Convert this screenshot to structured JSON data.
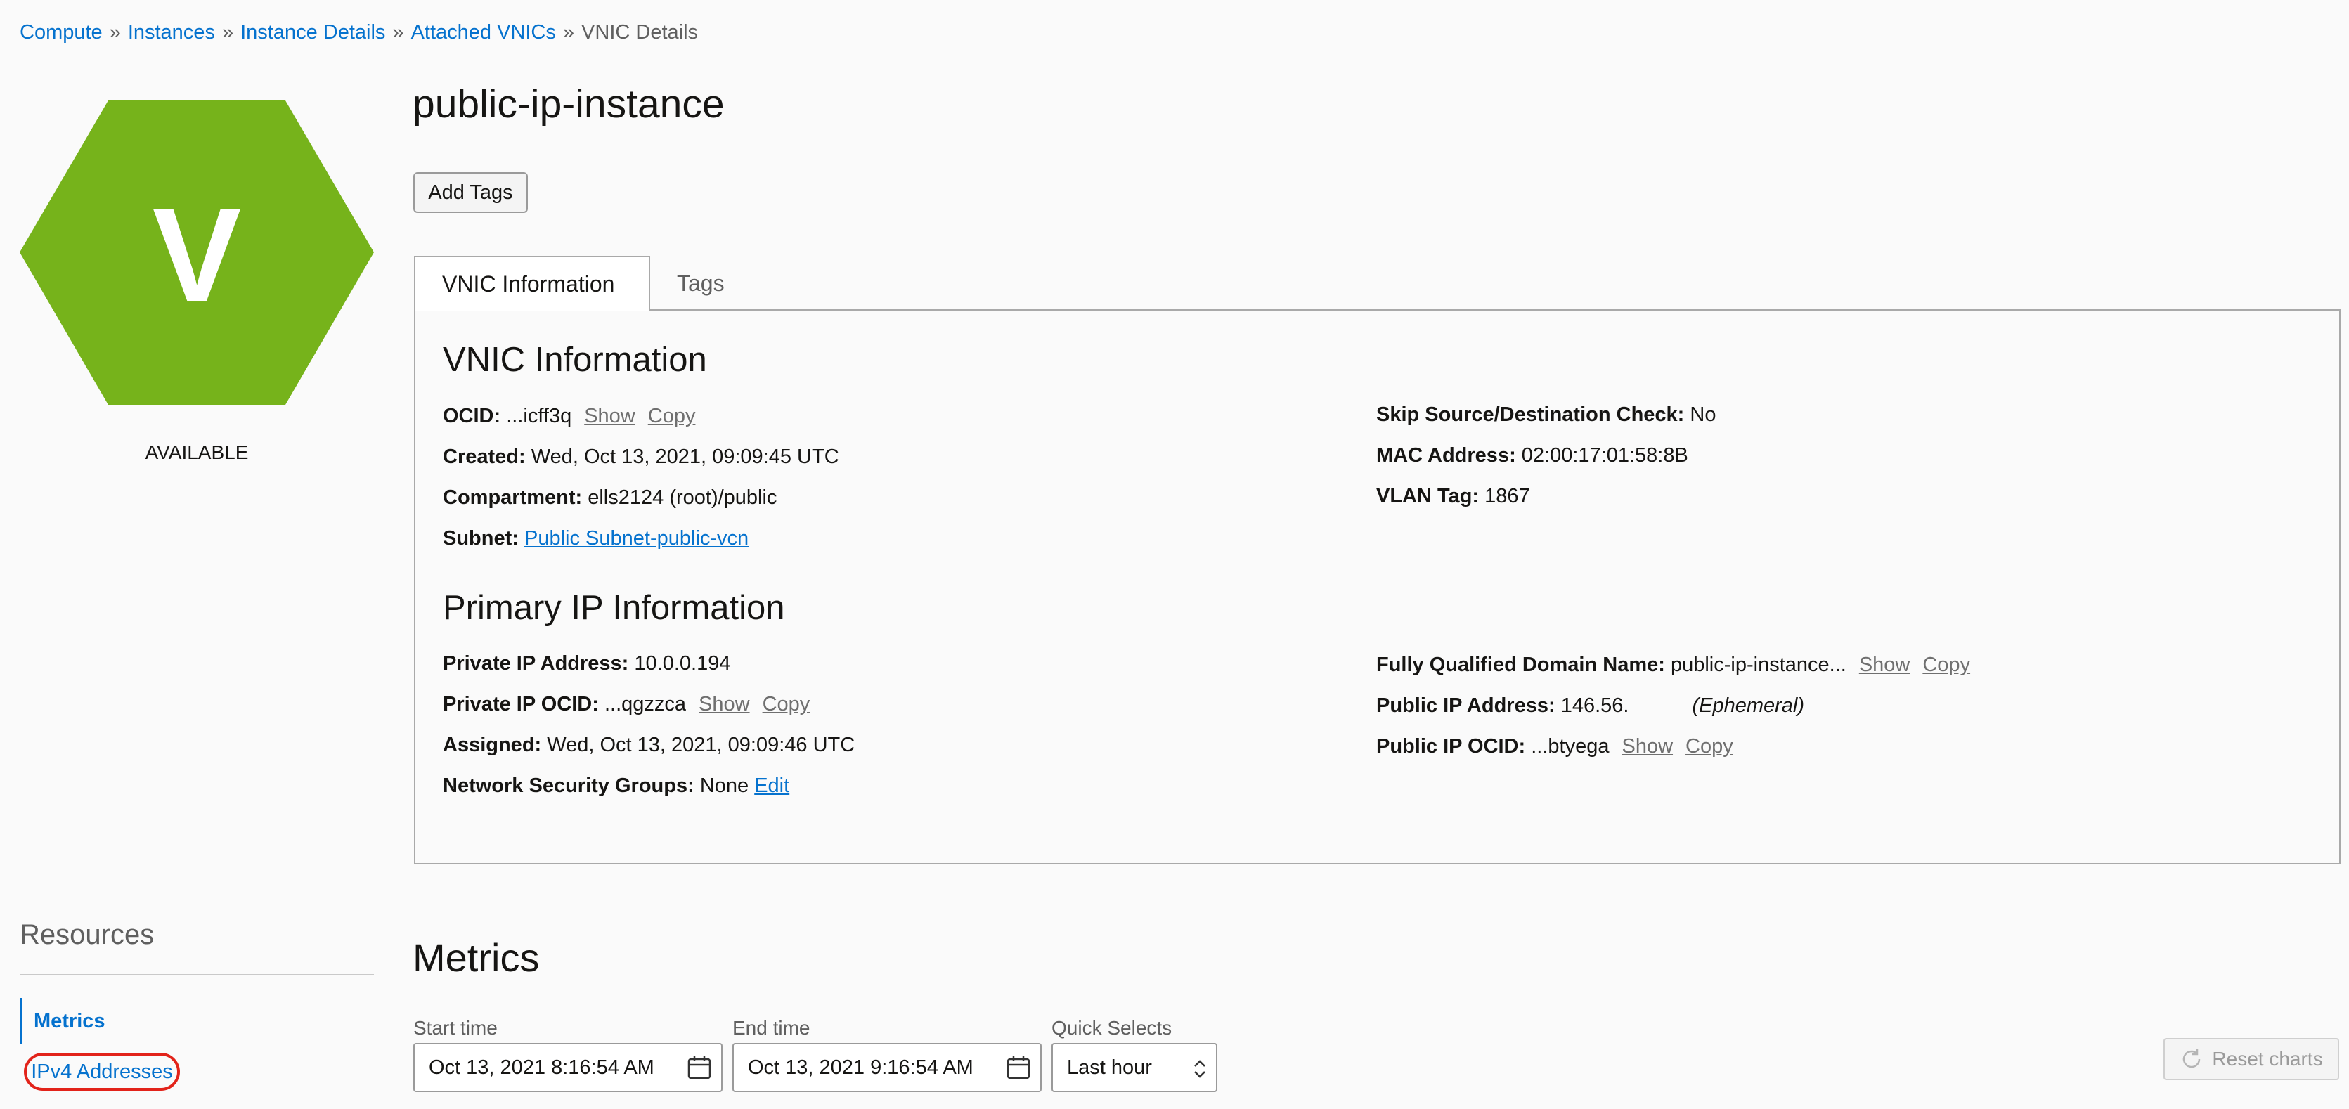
{
  "breadcrumb": {
    "items": [
      "Compute",
      "Instances",
      "Instance Details",
      "Attached VNICs"
    ],
    "current": "VNIC Details",
    "separator": "»"
  },
  "instance": {
    "icon_letter": "V",
    "status": "AVAILABLE",
    "status_color": "#76b31b",
    "name": "public-ip-instance"
  },
  "actions": {
    "add_tags": "Add Tags"
  },
  "tabs": [
    {
      "label": "VNIC Information",
      "active": true
    },
    {
      "label": "Tags",
      "active": false
    }
  ],
  "vnic": {
    "heading": "VNIC Information",
    "ocid": {
      "label": "OCID:",
      "value": "...icff3q",
      "show": "Show",
      "copy": "Copy"
    },
    "created": {
      "label": "Created:",
      "value": "Wed, Oct 13, 2021, 09:09:45 UTC"
    },
    "compartment": {
      "label": "Compartment:",
      "value": "ells2124 (root)/public"
    },
    "subnet": {
      "label": "Subnet:",
      "value": "Public Subnet-public-vcn"
    },
    "skip_check": {
      "label": "Skip Source/Destination Check:",
      "value": "No"
    },
    "mac": {
      "label": "MAC Address:",
      "value": "02:00:17:01:58:8B"
    },
    "vlan": {
      "label": "VLAN Tag:",
      "value": "1867"
    }
  },
  "primary_ip": {
    "heading": "Primary IP Information",
    "private_ip": {
      "label": "Private IP Address:",
      "value": "10.0.0.194"
    },
    "private_ocid": {
      "label": "Private IP OCID:",
      "value": "...qgzzca",
      "show": "Show",
      "copy": "Copy"
    },
    "assigned": {
      "label": "Assigned:",
      "value": "Wed, Oct 13, 2021, 09:09:46 UTC"
    },
    "nsg": {
      "label": "Network Security Groups:",
      "value": "None",
      "edit": "Edit"
    },
    "fqdn": {
      "label": "Fully Qualified Domain Name:",
      "value": "public-ip-instance...",
      "show": "Show",
      "copy": "Copy"
    },
    "public_ip": {
      "label": "Public IP Address:",
      "value": "146.56.",
      "note": "(Ephemeral)"
    },
    "public_ocid": {
      "label": "Public IP OCID:",
      "value": "...btyega",
      "show": "Show",
      "copy": "Copy"
    }
  },
  "resources": {
    "title": "Resources",
    "items": [
      {
        "label": "Metrics",
        "selected": true
      },
      {
        "label": "IPv4 Addresses",
        "selected": false
      }
    ]
  },
  "metrics": {
    "title": "Metrics",
    "start_label": "Start time",
    "start_value": "Oct 13, 2021 8:16:54 AM",
    "end_label": "End time",
    "end_value": "Oct 13, 2021 9:16:54 AM",
    "quick_label": "Quick Selects",
    "quick_value": "Last hour",
    "reset": "Reset charts"
  }
}
